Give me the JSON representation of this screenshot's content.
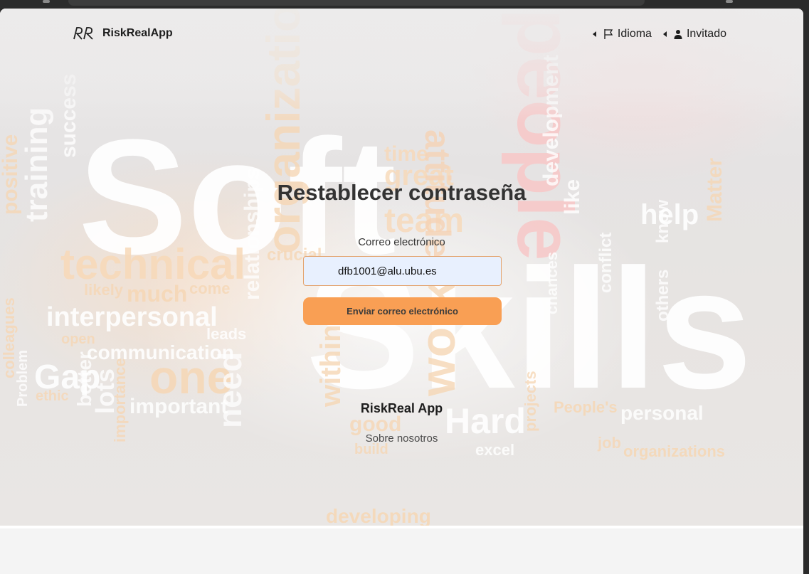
{
  "app": {
    "name": "RiskRealApp",
    "logo_text": "RR"
  },
  "nav": {
    "language": {
      "label": "Idioma",
      "icon": "flag-icon"
    },
    "user": {
      "label": "Invitado",
      "icon": "person-icon"
    }
  },
  "form": {
    "title": "Restablecer contraseña",
    "email_label": "Correo electrónico",
    "email_value": "dfb1001@alu.ubu.es",
    "submit_label": "Enviar correo electrónico"
  },
  "footer": {
    "title": "RiskReal App",
    "about_link": "Sobre nosotros"
  },
  "background_words": [
    "Soft",
    "Skills",
    "people",
    "technical",
    "interpersonal",
    "communication",
    "Gap",
    "one",
    "team",
    "great",
    "time",
    "attitude",
    "help",
    "important",
    "organization",
    "work",
    "Hard",
    "personal",
    "developing",
    "training",
    "success",
    "positive",
    "relationships",
    "within",
    "good",
    "excel",
    "organizations",
    "projects",
    "job",
    "lots",
    "need",
    "better",
    "others",
    "conflict",
    "chances",
    "development",
    "like",
    "know",
    "Matter",
    "much",
    "likely",
    "come",
    "crucial",
    "leads",
    "open",
    "ethic",
    "Problem",
    "colleagues",
    "importance",
    "build",
    "People's"
  ],
  "colors": {
    "accent": "#f99f54",
    "input_border": "#e4a36d",
    "input_bg": "#e8f0fe",
    "text": "#333333"
  }
}
